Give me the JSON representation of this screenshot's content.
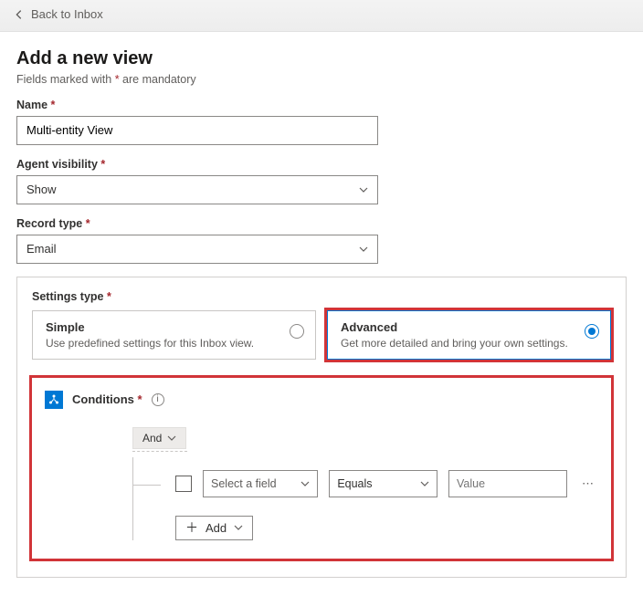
{
  "back_link": "Back to Inbox",
  "page_title": "Add a new view",
  "mandatory_prefix": "Fields marked with ",
  "mandatory_star": "*",
  "mandatory_suffix": " are mandatory",
  "fields": {
    "name": {
      "label": "Name",
      "value": "Multi-entity View"
    },
    "agent_visibility": {
      "label": "Agent visibility",
      "value": "Show"
    },
    "record_type": {
      "label": "Record type",
      "value": "Email"
    }
  },
  "settings_type": {
    "label": "Settings type",
    "simple": {
      "title": "Simple",
      "desc": "Use predefined settings for this Inbox view."
    },
    "advanced": {
      "title": "Advanced",
      "desc": "Get more detailed and bring your own settings."
    },
    "selected": "advanced"
  },
  "conditions": {
    "title": "Conditions",
    "operator": "And",
    "row": {
      "field_placeholder": "Select a field",
      "operator_value": "Equals",
      "value_placeholder": "Value"
    },
    "add_label": "Add"
  }
}
